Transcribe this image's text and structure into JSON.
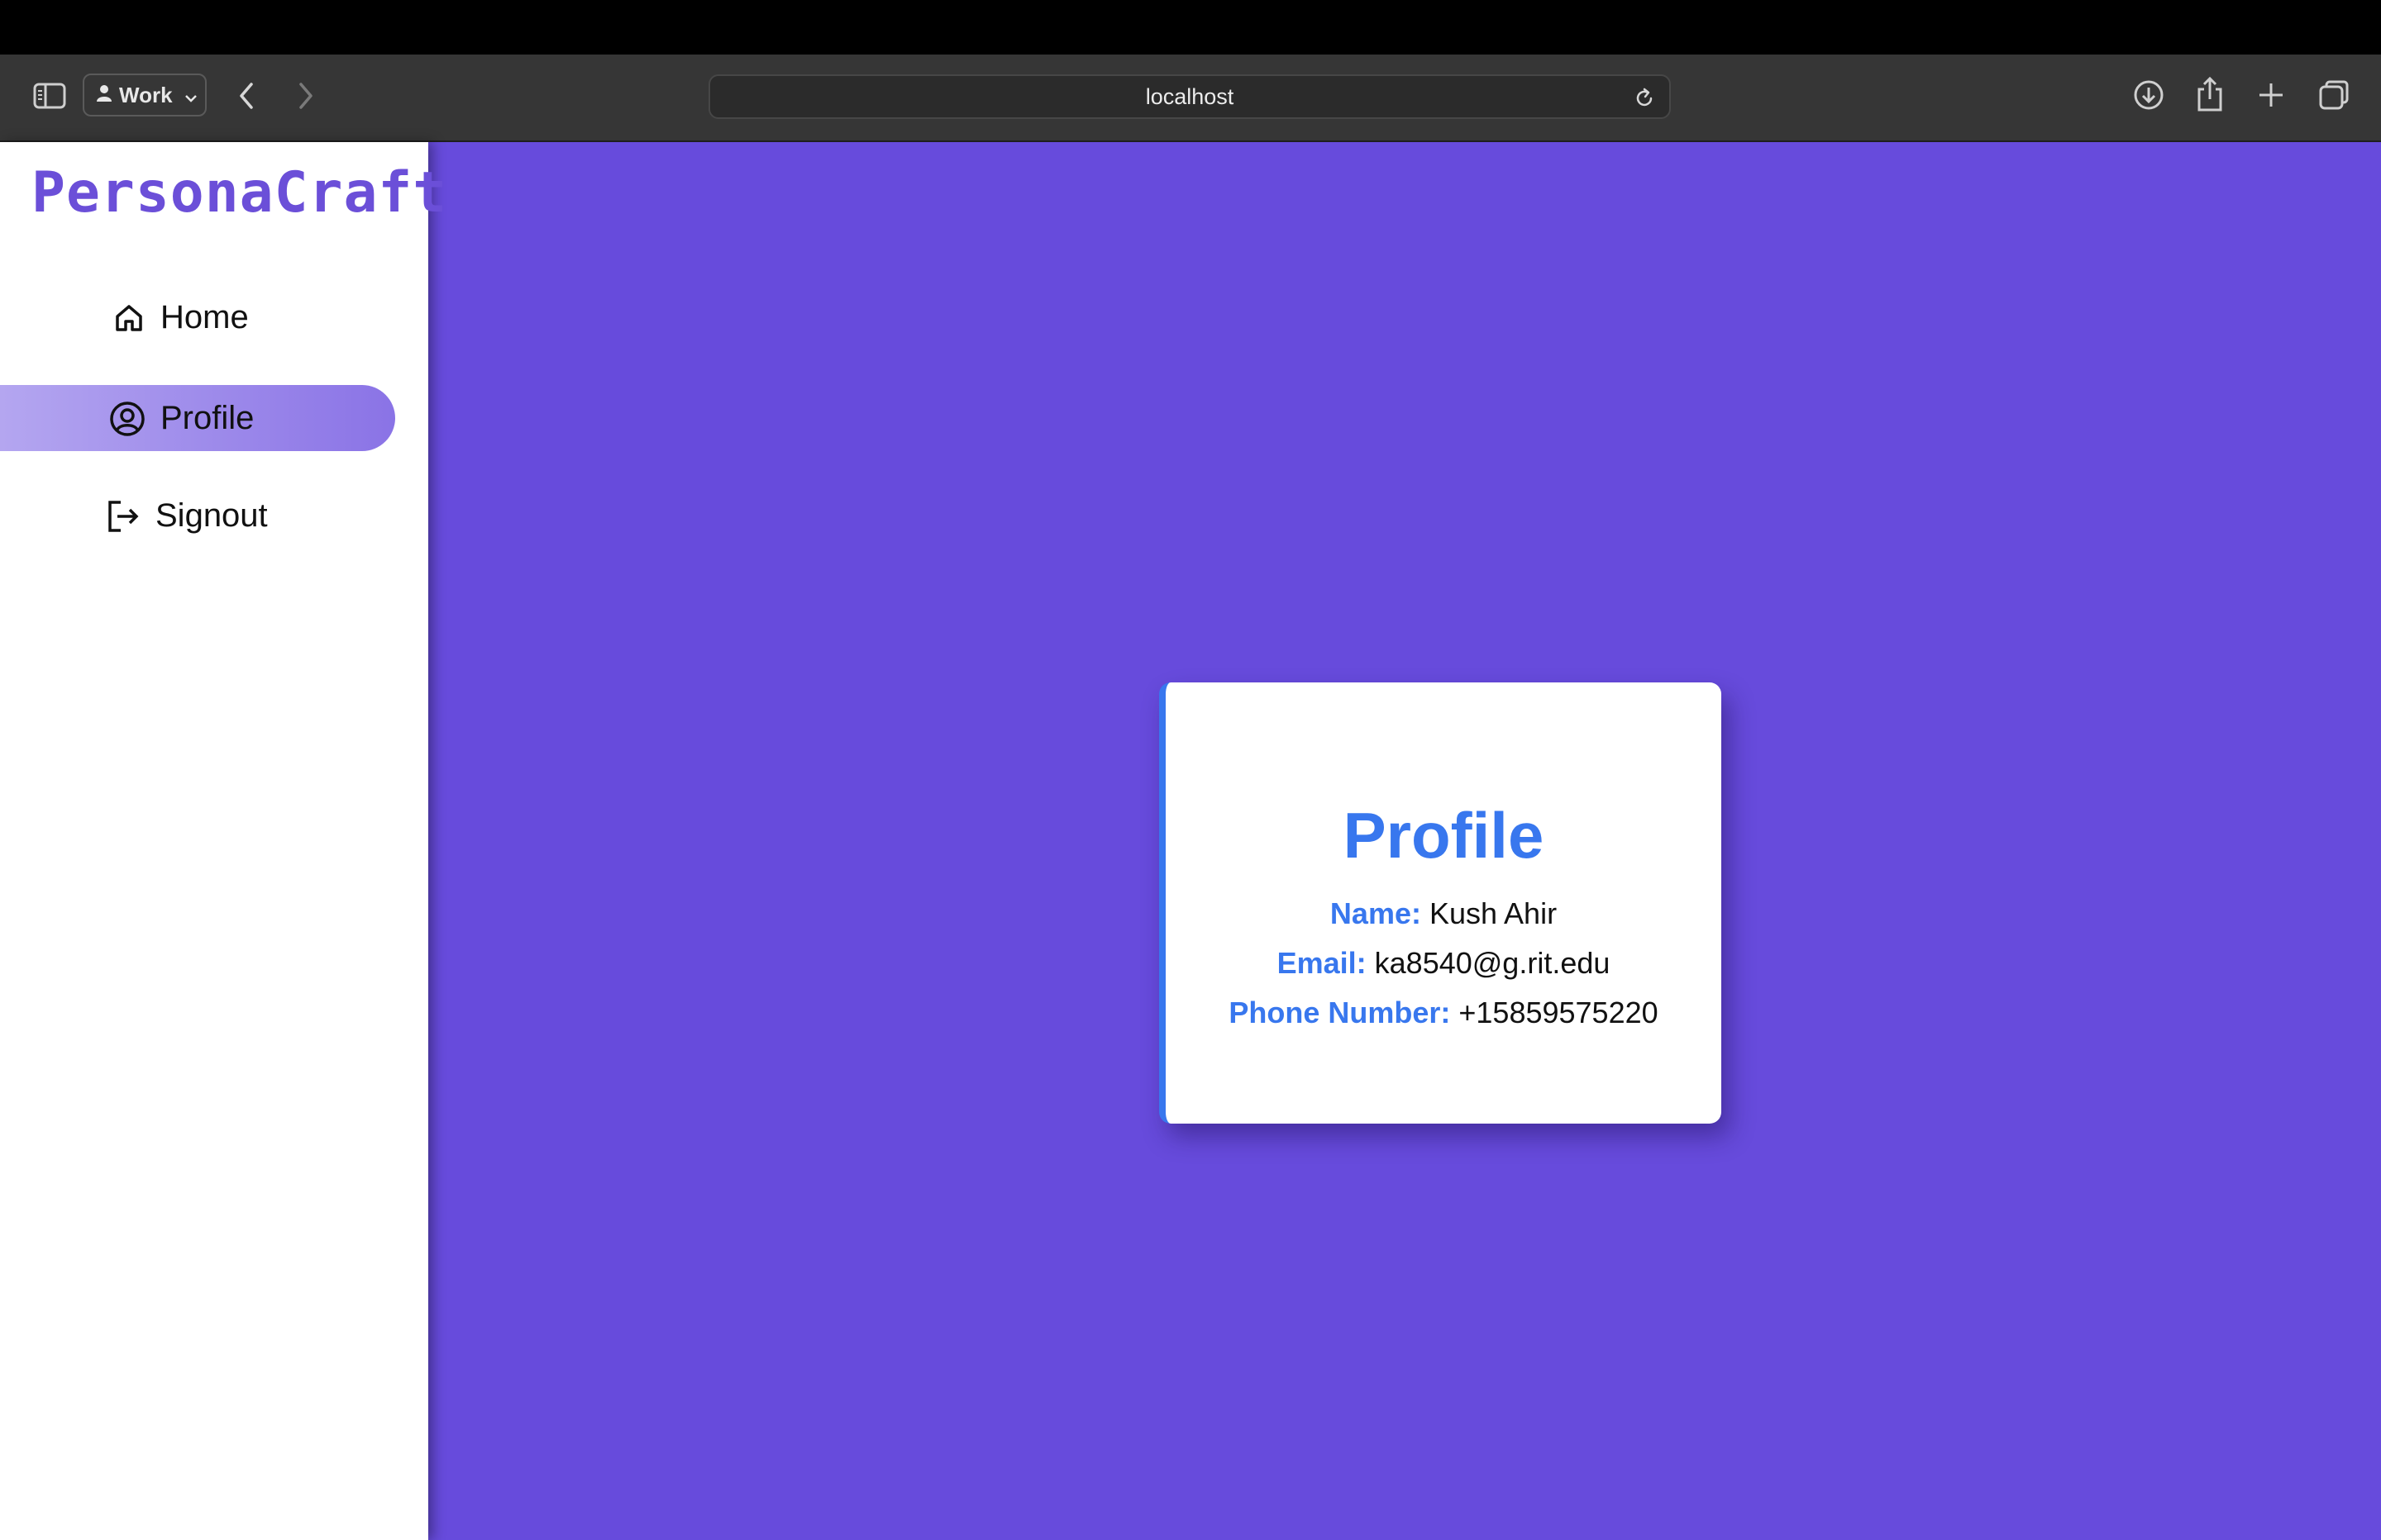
{
  "browser": {
    "profile_label": "Work",
    "url": "localhost"
  },
  "sidebar": {
    "brand": "PersonaCraft",
    "items": [
      {
        "label": "Home",
        "icon": "home-icon",
        "active": false
      },
      {
        "label": "Profile",
        "icon": "user-circle-icon",
        "active": true
      },
      {
        "label": "Signout",
        "icon": "signout-icon",
        "active": false
      }
    ]
  },
  "colors": {
    "brand": "#6b4fd8",
    "main_background": "#674bdc",
    "accent_blue": "#3877ee",
    "active_nav_gradient_start": "#b4a6f0",
    "active_nav_gradient_end": "#8a73e6"
  },
  "profile_card": {
    "title": "Profile",
    "fields": [
      {
        "label": "Name:",
        "value": "Kush Ahir"
      },
      {
        "label": "Email:",
        "value": "ka8540@g.rit.edu"
      },
      {
        "label": "Phone Number:",
        "value": "+15859575220"
      }
    ]
  }
}
